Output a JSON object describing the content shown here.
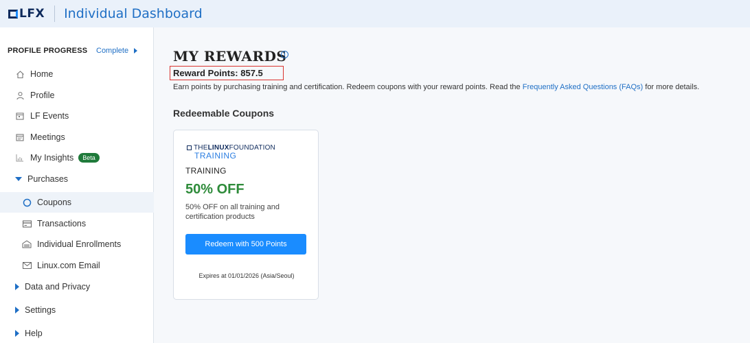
{
  "header": {
    "logo_text": "LFX",
    "title": "Individual Dashboard"
  },
  "sidebar": {
    "profile_progress_label": "PROFILE PROGRESS",
    "complete_label": "Complete",
    "items": [
      {
        "label": "Home",
        "icon": "home-icon"
      },
      {
        "label": "Profile",
        "icon": "user-icon"
      },
      {
        "label": "LF Events",
        "icon": "calendar-icon"
      },
      {
        "label": "Meetings",
        "icon": "meetings-calendar-icon"
      },
      {
        "label": "My Insights",
        "icon": "chart-icon",
        "badge": "Beta"
      },
      {
        "label": "Purchases",
        "icon": "chevron-down-icon",
        "expanded": true
      },
      {
        "label": "Coupons",
        "icon": "circle-icon",
        "active": true
      },
      {
        "label": "Transactions",
        "icon": "card-icon"
      },
      {
        "label": "Individual Enrollments",
        "icon": "enrollment-icon"
      },
      {
        "label": "Linux.com Email",
        "icon": "mail-icon"
      },
      {
        "label": "Data and Privacy",
        "icon": "chevron-right-icon"
      },
      {
        "label": "Settings",
        "icon": "chevron-right-icon"
      },
      {
        "label": "Help",
        "icon": "chevron-right-icon"
      }
    ]
  },
  "main": {
    "title": "MY REWARDS",
    "reward_points": "Reward Points: 857.5",
    "description_prefix": "Earn points by purchasing training and certification. Redeem coupons with your reward points. Read the ",
    "faq_link": "Frequently Asked Questions (FAQs)",
    "description_suffix": " for more details.",
    "coupons_heading": "Redeemable Coupons"
  },
  "coupon": {
    "brand_line1_the": "THE",
    "brand_line1_linux": "LINUX",
    "brand_line1_foundation": "FOUNDATION",
    "brand_line2": "TRAINING",
    "type": "TRAINING",
    "discount": "50% OFF",
    "description": "50% OFF on all training and certification products",
    "button_label": "Redeem with 500 Points",
    "expires": "Expires at 01/01/2026 (Asia/Seoul)"
  },
  "colors": {
    "accent": "#1a8cff",
    "discount_green": "#2e8b3a",
    "highlight_red": "#d9322e"
  }
}
